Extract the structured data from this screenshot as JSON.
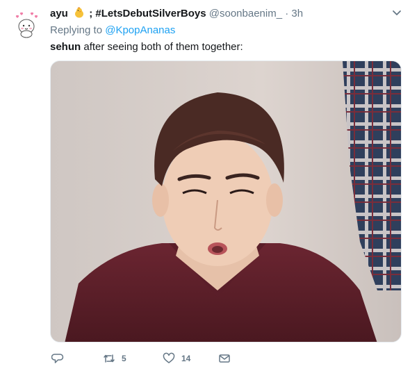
{
  "tweet": {
    "author_name": "ayu",
    "author_name_suffix": "; #LetsDebutSilverBoys",
    "handle": "@soonbaenim_",
    "separator": "·",
    "time": "3h",
    "reply_prefix": "Replying to",
    "reply_to": "@KpopAnanas",
    "text_bold": "sehun",
    "text_rest": " after seeing both of them together:"
  },
  "actions": {
    "reply_count": "",
    "retweet_count": "5",
    "like_count": "14"
  },
  "icons": {
    "avatar": "cartoon-avatar-icon",
    "emoji": "chick-emoji-icon",
    "caret": "chevron-down-icon",
    "reply": "reply-icon",
    "retweet": "retweet-icon",
    "like": "heart-icon",
    "dm": "mail-icon"
  },
  "colors": {
    "link": "#1da1f2",
    "muted": "#657786",
    "text": "#14171a"
  }
}
